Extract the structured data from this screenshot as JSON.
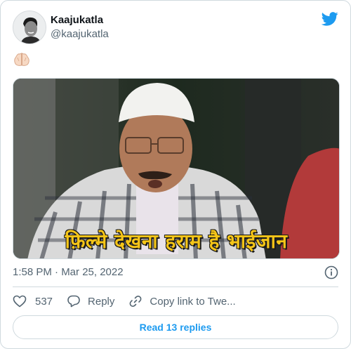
{
  "author": {
    "name": "Kaajukatla",
    "handle": "@kaajukatla"
  },
  "tweet": {
    "emoji_icon": "folded-hands-emoji",
    "media_caption": "फ़िल्मे देखना हराम है भाईजान",
    "timestamp": "1:58 PM · Mar 25, 2022"
  },
  "actions": {
    "like_count": "537",
    "reply_label": "Reply",
    "copy_link_label": "Copy link to Twe..."
  },
  "read_replies_label": "Read 13 replies",
  "colors": {
    "brand": "#1d9bf0",
    "caption": "#f5c518",
    "secondary_text": "#536471"
  }
}
